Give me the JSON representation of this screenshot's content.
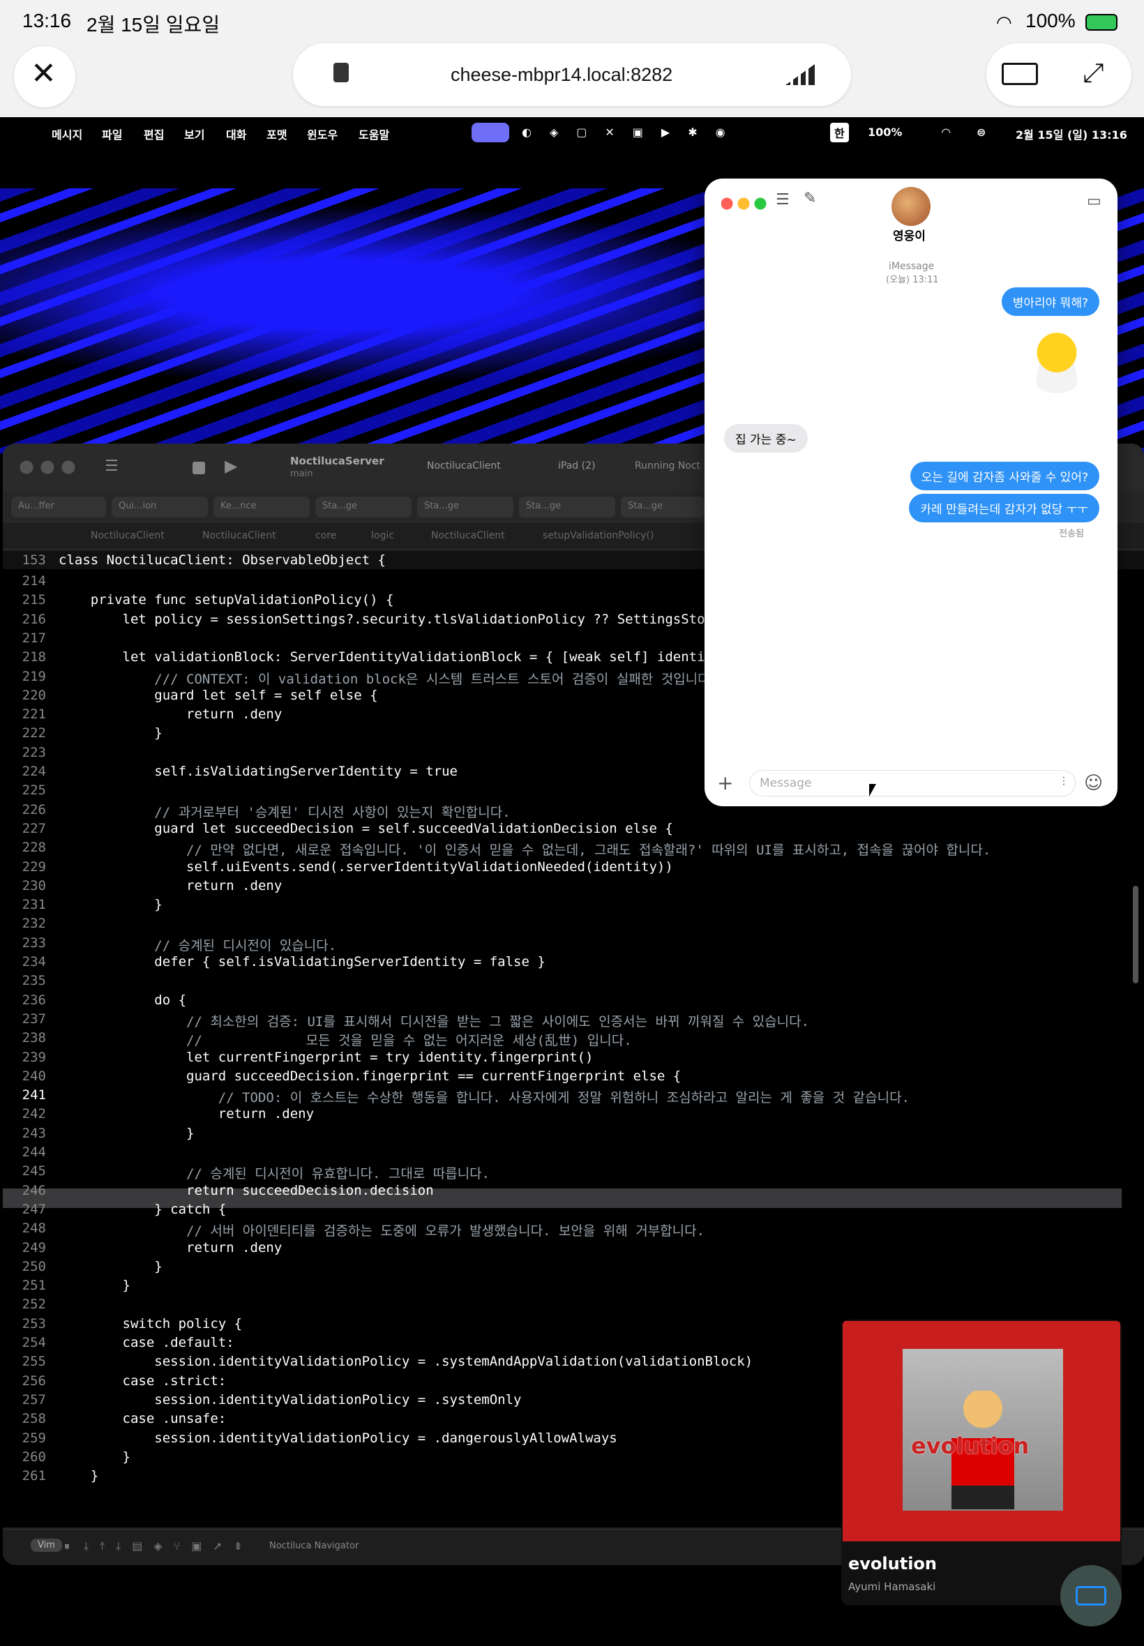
{
  "ipad": {
    "time": "13:16",
    "date": "2월 15일 일요일",
    "battery": "100%",
    "url": "cheese-mbpr14.local:8282"
  },
  "menubar": {
    "items": [
      "메시지",
      "파일",
      "편집",
      "보기",
      "대화",
      "포맷",
      "윈도우",
      "도움말"
    ],
    "battery": "100%",
    "input_method": "한",
    "datetime": "2월 15일 (일) 13:16"
  },
  "xcode": {
    "scheme": "NoctilucaServer",
    "branch": "main",
    "target": "NoctilucaClient",
    "device": "iPad (2)",
    "status": "Running Noct",
    "tabs": [
      "Au...ffer",
      "Qui...ion",
      "Ke...nce",
      "Sta...ge",
      "Sta...ge",
      "Sta...ge",
      "Sta...ge"
    ],
    "breadcrumb": [
      "NoctilucaClient",
      "NoctilucaClient",
      "core",
      "logic",
      "NoctilucaClient",
      "setupValidationPolicy()"
    ],
    "sticky_line_number": "153",
    "sticky_line": "class NoctilucaClient: ObservableObject {",
    "vim_label": "Vim",
    "navigator_label": "Noctiluca Navigator",
    "lines": [
      {
        "n": "214",
        "t": ""
      },
      {
        "n": "215",
        "t": "    private func setupValidationPolicy() {"
      },
      {
        "n": "216",
        "t": "        let policy = sessionSettings?.security.tlsValidationPolicy ?? SettingsStore.s"
      },
      {
        "n": "217",
        "t": ""
      },
      {
        "n": "218",
        "t": "        let validationBlock: ServerIdentityValidationBlock = { [weak self] identity i"
      },
      {
        "n": "219",
        "t": "            /// CONTEXT: 이 validation block은 시스템 트러스트 스토어 검증이 실패한 것입니다"
      },
      {
        "n": "220",
        "t": "            guard let self = self else {"
      },
      {
        "n": "221",
        "t": "                return .deny"
      },
      {
        "n": "222",
        "t": "            }"
      },
      {
        "n": "223",
        "t": ""
      },
      {
        "n": "224",
        "t": "            self.isValidatingServerIdentity = true"
      },
      {
        "n": "225",
        "t": ""
      },
      {
        "n": "226",
        "t": "            // 과거로부터 '승계된' 디시전 사항이 있는지 확인합니다."
      },
      {
        "n": "227",
        "t": "            guard let succeedDecision = self.succeedValidationDecision else {"
      },
      {
        "n": "228",
        "t": "                // 만약 없다면, 새로운 접속입니다. '이 인증서 믿을 수 없는데, 그래도 접속할래?' 따위의 UI를 표시하고, 접속을 끊어야 합니다."
      },
      {
        "n": "229",
        "t": "                self.uiEvents.send(.serverIdentityValidationNeeded(identity))"
      },
      {
        "n": "230",
        "t": "                return .deny"
      },
      {
        "n": "231",
        "t": "            }"
      },
      {
        "n": "232",
        "t": ""
      },
      {
        "n": "233",
        "t": "            // 승계된 디시전이 있습니다."
      },
      {
        "n": "234",
        "t": "            defer { self.isValidatingServerIdentity = false }"
      },
      {
        "n": "235",
        "t": ""
      },
      {
        "n": "236",
        "t": "            do {"
      },
      {
        "n": "237",
        "t": "                // 최소한의 검증: UI를 표시해서 디시전을 받는 그 짧은 사이에도 인증서는 바뀌 끼워질 수 있습니다."
      },
      {
        "n": "238",
        "t": "                //             모든 것을 믿을 수 없는 어지러운 세상(乱世) 입니다."
      },
      {
        "n": "239",
        "t": "                let currentFingerprint = try identity.fingerprint()"
      },
      {
        "n": "240",
        "t": "                guard succeedDecision.fingerprint == currentFingerprint else {"
      },
      {
        "n": "241",
        "t": "                    // TODO: 이 호스트는 수상한 행동을 합니다. 사용자에게 정말 위험하니 조심하라고 알리는 게 좋을 것 같습니다."
      },
      {
        "n": "242",
        "t": "                    return .deny"
      },
      {
        "n": "243",
        "t": "                }"
      },
      {
        "n": "244",
        "t": ""
      },
      {
        "n": "245",
        "t": "                // 승계된 디시전이 유효합니다. 그대로 따릅니다."
      },
      {
        "n": "246",
        "t": "                return succeedDecision.decision"
      },
      {
        "n": "247",
        "t": "            } catch {"
      },
      {
        "n": "248",
        "t": "                // 서버 아이덴티티를 검증하는 도중에 오류가 발생했습니다. 보안을 위해 거부합니다."
      },
      {
        "n": "249",
        "t": "                return .deny"
      },
      {
        "n": "250",
        "t": "            }"
      },
      {
        "n": "251",
        "t": "        }"
      },
      {
        "n": "252",
        "t": ""
      },
      {
        "n": "253",
        "t": "        switch policy {"
      },
      {
        "n": "254",
        "t": "        case .default:"
      },
      {
        "n": "255",
        "t": "            session.identityValidationPolicy = .systemAndAppValidation(validationBlock)"
      },
      {
        "n": "256",
        "t": "        case .strict:"
      },
      {
        "n": "257",
        "t": "            session.identityValidationPolicy = .systemOnly"
      },
      {
        "n": "258",
        "t": "        case .unsafe:"
      },
      {
        "n": "259",
        "t": "            session.identityValidationPolicy = .dangerouslyAllowAlways"
      },
      {
        "n": "260",
        "t": "        }"
      },
      {
        "n": "261",
        "t": "    }"
      }
    ]
  },
  "messages": {
    "contact": "영웅이",
    "service": "iMessage",
    "timestamp": "(오늘) 13:11",
    "outgoing_1": "병아리야 뭐해?",
    "incoming_1": "집 가는 중~",
    "outgoing_2": "오는 길에 감자좀 사와줄 수 있어?",
    "outgoing_3": "카레 만들려는데 감자가 없당 ㅜㅜ",
    "delivery": "전송됨",
    "input_placeholder": "Message"
  },
  "now_playing": {
    "title": "evolution",
    "artist": "Ayumi Hamasaki",
    "art_text": "evolution"
  },
  "colors": {
    "bubble_blue": "#2e92f6",
    "album_red": "#c81e1e"
  }
}
